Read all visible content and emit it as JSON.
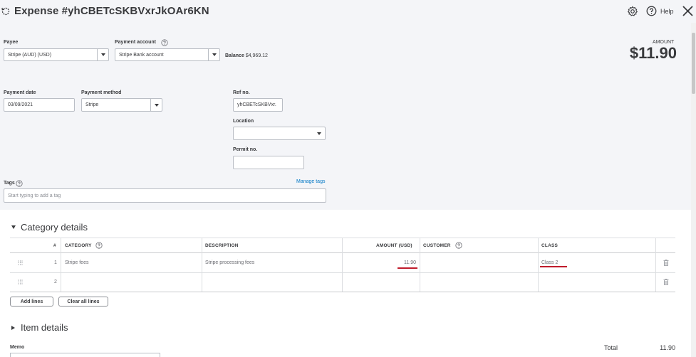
{
  "header": {
    "title": "Expense #yhCBETcSKBVxrJkOAr6KN",
    "help_label": "Help"
  },
  "form": {
    "payee": {
      "label": "Payee",
      "value": "Stripe (AUD) (USD)"
    },
    "payment_account": {
      "label": "Payment account",
      "value": "Stripe Bank account"
    },
    "balance": {
      "label": "Balance",
      "value": "$4,969.12"
    },
    "amount": {
      "label": "AMOUNT",
      "value": "$11.90"
    },
    "payment_date": {
      "label": "Payment date",
      "value": "03/09/2021"
    },
    "payment_method": {
      "label": "Payment method",
      "value": "Stripe"
    },
    "ref_no": {
      "label": "Ref no.",
      "value": "yhCBETcSKBVxr."
    },
    "location": {
      "label": "Location",
      "value": ""
    },
    "permit_no": {
      "label": "Permit no.",
      "value": ""
    },
    "tags": {
      "label": "Tags",
      "placeholder": "Start typing to add a tag",
      "manage_link": "Manage tags"
    }
  },
  "category_details": {
    "title": "Category details",
    "columns": {
      "num": "#",
      "category": "CATEGORY",
      "description": "DESCRIPTION",
      "amount": "AMOUNT (USD)",
      "customer": "CUSTOMER",
      "class": "CLASS"
    },
    "rows": [
      {
        "num": "1",
        "category": "Stripe fees",
        "description": "Stripe processing fees",
        "amount": "11.90",
        "customer": "",
        "class": "Class 2"
      },
      {
        "num": "2",
        "category": "",
        "description": "",
        "amount": "",
        "customer": "",
        "class": ""
      }
    ],
    "add_lines_label": "Add lines",
    "clear_lines_label": "Clear all lines"
  },
  "item_details": {
    "title": "Item details"
  },
  "memo": {
    "label": "Memo"
  },
  "total": {
    "label": "Total",
    "value": "11.90"
  },
  "colors": {
    "link": "#0077c5",
    "error_underline": "#c01b2b",
    "panel": "#f4f5f8"
  }
}
